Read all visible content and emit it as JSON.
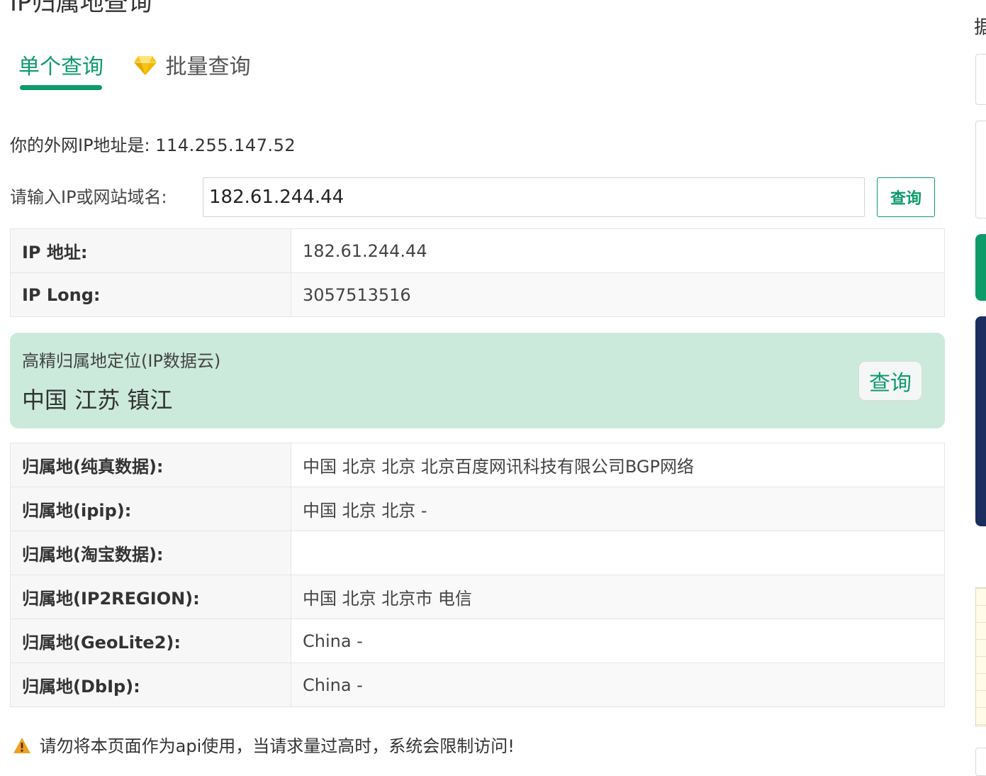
{
  "page_title": "IP归属地查询",
  "tabs": {
    "single": "单个查询",
    "batch": "批量查询"
  },
  "my_ip": {
    "label": "你的外网IP地址是:",
    "value": "114.255.147.52"
  },
  "query": {
    "label": "请输入IP或网站域名:",
    "input_value": "182.61.244.44",
    "button": "查询"
  },
  "basic_rows": [
    {
      "key": "IP 地址:",
      "value": "182.61.244.44"
    },
    {
      "key": "IP Long:",
      "value": "3057513516"
    }
  ],
  "cloud": {
    "title": "高精归属地定位(IP数据云)",
    "value": "中国 江苏 镇江",
    "button": "查询"
  },
  "location_rows": [
    {
      "key": "归属地(纯真数据):",
      "value": "中国 北京 北京 北京百度网讯科技有限公司BGP网络"
    },
    {
      "key": "归属地(ipip):",
      "value": "中国 北京 北京 -"
    },
    {
      "key": "归属地(淘宝数据):",
      "value": ""
    },
    {
      "key": "归属地(IP2REGION):",
      "value": "中国 北京 北京市 电信"
    },
    {
      "key": "归属地(GeoLite2):",
      "value": "China -"
    },
    {
      "key": "归属地(DbIp):",
      "value": "China -"
    }
  ],
  "warning": "请勿将本页面作为api使用，当请求量过高时，系统会限制访问!",
  "side_char": "据",
  "icons": {
    "batch_tab": "diamond-icon",
    "warning": "warning-icon"
  },
  "colors": {
    "accent": "#0d9b6a",
    "cloud_bg": "#cbeadc",
    "gem": "#f5c518",
    "warning": "#f0a020"
  }
}
